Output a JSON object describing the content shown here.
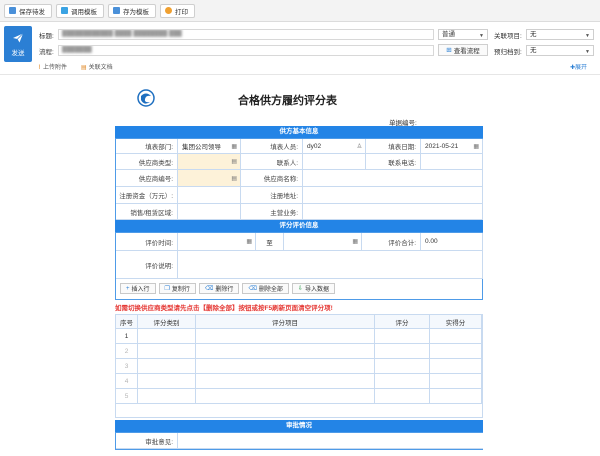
{
  "toolbar": {
    "buttons": [
      {
        "label": "保存待发",
        "color": "#4a90d9"
      },
      {
        "label": "调用模板",
        "color": "#3aa3e3"
      },
      {
        "label": "存为模板",
        "color": "#4a90d9"
      },
      {
        "label": "打印",
        "color": "#f0a030"
      }
    ]
  },
  "header": {
    "send_label": "发送",
    "title_label": "标题:",
    "flow_label": "流程:",
    "flow_placeholder": "",
    "importance_value": "普通",
    "flow_view_label": "查看流程",
    "related_project_label": "关联项目:",
    "related_project_value": "无",
    "archive_label": "预归档到:",
    "archive_value": "无",
    "attach_label": "上传附件",
    "relate_doc_label": "关联文档",
    "expand_label": "展开"
  },
  "form": {
    "title": "合格供方履约评分表",
    "doc_no_label": "单据编号:",
    "basic_section": "供方基本信息",
    "fields": {
      "dept_label": "填表部门:",
      "dept_value": "集团公司领导",
      "filler_label": "填表人员:",
      "filler_value": "dy02",
      "date_label": "填表日期:",
      "date_value": "2021-05-21",
      "supplier_type_label": "供应商类型:",
      "contact_label": "联系人:",
      "phone_label": "联系电话:",
      "supplier_no_label": "供应商编号:",
      "supplier_name_label": "供应商名称:",
      "capital_label": "注册资金（万元）:",
      "address_label": "注册地址:",
      "region_label": "销售/租赁区域:",
      "business_label": "主营业务:"
    },
    "eval_section": "评分评价信息",
    "eval": {
      "time_label": "评价时间:",
      "to_label": "至",
      "total_label": "评价合计:",
      "total_value": "0.00",
      "desc_label": "评价说明:"
    },
    "ops": [
      "插入行",
      "复制行",
      "删除行",
      "删除全部",
      "导入数据"
    ],
    "warning": "如需切换供应商类型请先点击【删除全部】按钮或按F5刷新页面清空评分项!",
    "grid_headers": [
      "序号",
      "评分类别",
      "评分项目",
      "评分",
      "实得分"
    ],
    "rows": [
      "1",
      "2",
      "3",
      "4",
      "5"
    ],
    "approval_section": "审批情况",
    "approval_label": "审批意见:"
  }
}
